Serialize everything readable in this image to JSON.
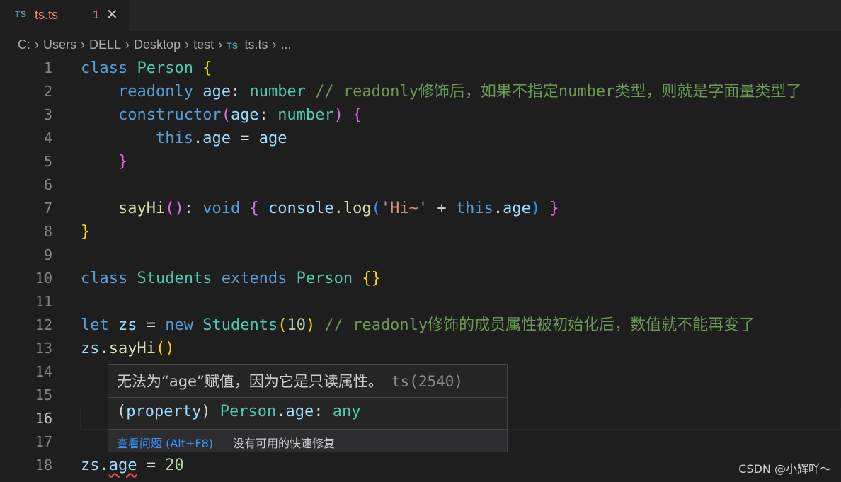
{
  "tab": {
    "badge": "TS",
    "filename": "ts.ts",
    "error_count": "1",
    "close_glyph": "✕"
  },
  "breadcrumb": {
    "items": [
      "C:",
      "Users",
      "DELL",
      "Desktop",
      "test"
    ],
    "file_badge": "TS",
    "file": "ts.ts",
    "more": "..."
  },
  "line_numbers": [
    "1",
    "2",
    "3",
    "4",
    "5",
    "6",
    "7",
    "8",
    "9",
    "10",
    "11",
    "12",
    "13",
    "14",
    "15",
    "16",
    "17",
    "18"
  ],
  "active_line": "16",
  "code": {
    "l1": {
      "kw": "class",
      "cls": "Person",
      "brace": "{"
    },
    "l2": {
      "kw": "readonly",
      "prop": "age",
      "colon": ":",
      "type": "number",
      "comment": "// readonly修饰后，如果不指定number类型，则就是字面量类型了"
    },
    "l3": {
      "kw": "constructor",
      "open": "(",
      "param": "age",
      "colon": ":",
      "type": "number",
      "close": ")",
      "brace": "{"
    },
    "l4": {
      "kw": "this",
      "dot": ".",
      "prop": "age",
      "eq": "=",
      "val": "age"
    },
    "l5": {
      "brace": "}"
    },
    "l7": {
      "fn": "sayHi",
      "parens": "()",
      "colon": ":",
      "type": "void",
      "open": "{",
      "obj": "console",
      "dot": ".",
      "method": "log",
      "p_open": "(",
      "str": "'Hi~'",
      "plus": "+",
      "kw": "this",
      "dot2": ".",
      "prop": "age",
      "p_close": ")",
      "close": "}"
    },
    "l8": {
      "brace": "}"
    },
    "l10": {
      "kw": "class",
      "cls": "Students",
      "kw2": "extends",
      "cls2": "Person",
      "braces": "{}"
    },
    "l12": {
      "kw": "let",
      "var": "zs",
      "eq": "=",
      "kw2": "new",
      "cls": "Students",
      "open": "(",
      "num": "10",
      "close": ")",
      "comment": "// readonly修饰的成员属性被初始化后，数值就不能再变了"
    },
    "l13": {
      "var": "zs",
      "dot": ".",
      "fn": "sayHi",
      "parens": "()"
    },
    "l18": {
      "var": "zs",
      "dot": ".",
      "prop": "age",
      "eq": "=",
      "num": "20"
    }
  },
  "hover": {
    "message": "无法为“age”赋值，因为它是只读属性。",
    "error_code": "ts(2540)",
    "sig_paren_open": "(",
    "sig_kind": "property",
    "sig_paren_close": ")",
    "sig_class": "Person",
    "sig_dot": ".",
    "sig_prop": "age",
    "sig_colon": ":",
    "sig_type": "any",
    "view_problem": "查看问题 (Alt+F8)",
    "no_fix": "没有可用的快速修复"
  },
  "watermark": "CSDN @小辉吖～",
  "colors": {
    "background": "#1e1e1e",
    "error": "#f48771",
    "keyword": "#569cd6",
    "class": "#4ec9b0",
    "comment": "#6a9955",
    "link": "#3794ff"
  }
}
